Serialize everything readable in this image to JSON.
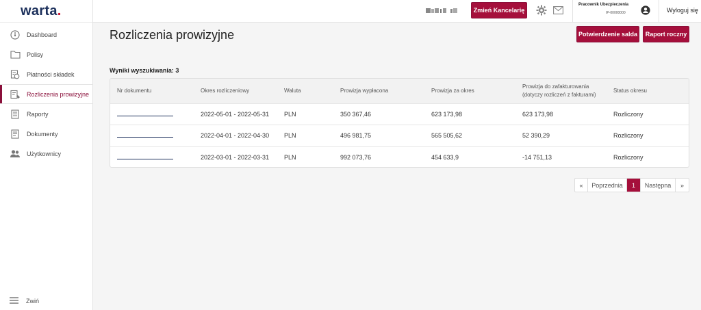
{
  "brand": {
    "logo_text": "warta",
    "logo_dot": "."
  },
  "sidebar": {
    "items": [
      {
        "label": "Dashboard",
        "icon": "dashboard-icon"
      },
      {
        "label": "Polisy",
        "icon": "folder-icon"
      },
      {
        "label": "Płatności składek",
        "icon": "payments-icon"
      },
      {
        "label": "Rozliczenia prowizyjne",
        "icon": "commission-icon",
        "active": true
      },
      {
        "label": "Raporty",
        "icon": "report-icon"
      },
      {
        "label": "Dokumenty",
        "icon": "document-icon"
      },
      {
        "label": "Użytkownicy",
        "icon": "users-icon"
      }
    ],
    "collapse_label": "Zwiń"
  },
  "topbar": {
    "change_office_label": "Zmień Kancelarię",
    "user_name": "Pracownik Ubezpieczenia",
    "user_id": "IP-00000000",
    "logout_label": "Wyloguj się"
  },
  "main": {
    "title": "Rozliczenia prowizyjne",
    "confirm_balance_label": "Potwierdzenie salda",
    "annual_report_label": "Raport roczny",
    "results_label": "Wyniki wyszukiwania: 3"
  },
  "table": {
    "headers": {
      "doc_no": "Nr dokumentu",
      "period": "Okres rozliczeniowy",
      "currency": "Waluta",
      "paid": "Prowizja wypłacona",
      "for_period": "Prowizja za okres",
      "to_invoice_1": "Prowizja do zafakturowania",
      "to_invoice_2": "(dotyczy rozliczeń z fakturami)",
      "status": "Status okresu"
    },
    "rows": [
      {
        "period": "2022-05-01 - 2022-05-31",
        "currency": "PLN",
        "paid": "350 367,46",
        "for_period": "623 173,98",
        "to_invoice": "623 173,98",
        "status": "Rozliczony"
      },
      {
        "period": "2022-04-01 - 2022-04-30",
        "currency": "PLN",
        "paid": "496 981,75",
        "for_period": "565 505,62",
        "to_invoice": "52 390,29",
        "status": "Rozliczony"
      },
      {
        "period": "2022-03-01 - 2022-03-31",
        "currency": "PLN",
        "paid": "992 073,76",
        "for_period": "454 633,9",
        "to_invoice": "-14 751,13",
        "status": "Rozliczony"
      }
    ]
  },
  "pagination": {
    "first": "«",
    "prev": "Poprzednia",
    "current": "1",
    "next": "Następna",
    "last": "»"
  },
  "colors": {
    "accent": "#a50f3b",
    "brand_navy": "#1a2e5a"
  }
}
